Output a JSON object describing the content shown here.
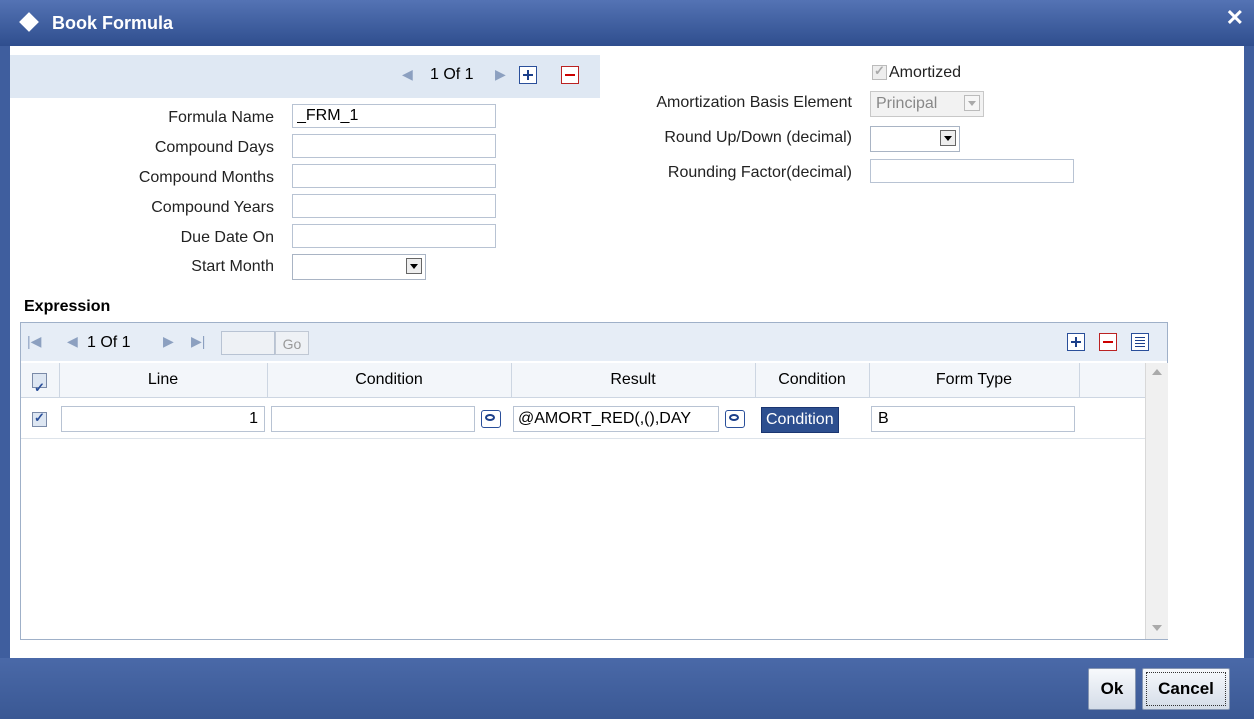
{
  "window": {
    "title": "Book Formula"
  },
  "header_nav": {
    "page_text": "1 Of 1"
  },
  "left_form": {
    "formula_name": {
      "label": "Formula Name",
      "value": "_FRM_1"
    },
    "compound_days": {
      "label": "Compound Days",
      "value": ""
    },
    "compound_months": {
      "label": "Compound Months",
      "value": ""
    },
    "compound_years": {
      "label": "Compound Years",
      "value": ""
    },
    "due_date_on": {
      "label": "Due Date On",
      "value": ""
    },
    "start_month": {
      "label": "Start Month",
      "value": ""
    }
  },
  "right_form": {
    "amortized": {
      "label": "Amortized",
      "checked": true
    },
    "amortization_basis": {
      "label": "Amortization Basis Element",
      "value": "Principal"
    },
    "round_updown": {
      "label": "Round Up/Down (decimal)",
      "value": ""
    },
    "rounding_factor": {
      "label": "Rounding Factor(decimal)",
      "value": ""
    }
  },
  "expression": {
    "title": "Expression",
    "nav_text": "1 Of 1",
    "go_label": "Go",
    "columns": [
      "Line",
      "Condition",
      "Result",
      "Condition",
      "Form Type"
    ],
    "rows": [
      {
        "line": "1",
        "condition": "",
        "result": "@AMORT_RED(,(),DAY",
        "condition_btn": "Condition",
        "form_type": "B"
      }
    ]
  },
  "buttons": {
    "ok": "Ok",
    "cancel": "Cancel"
  },
  "colors": {
    "titlebar": "#3a5a9c",
    "strip": "#dfe8f3",
    "accent": "#2d4f8f"
  }
}
